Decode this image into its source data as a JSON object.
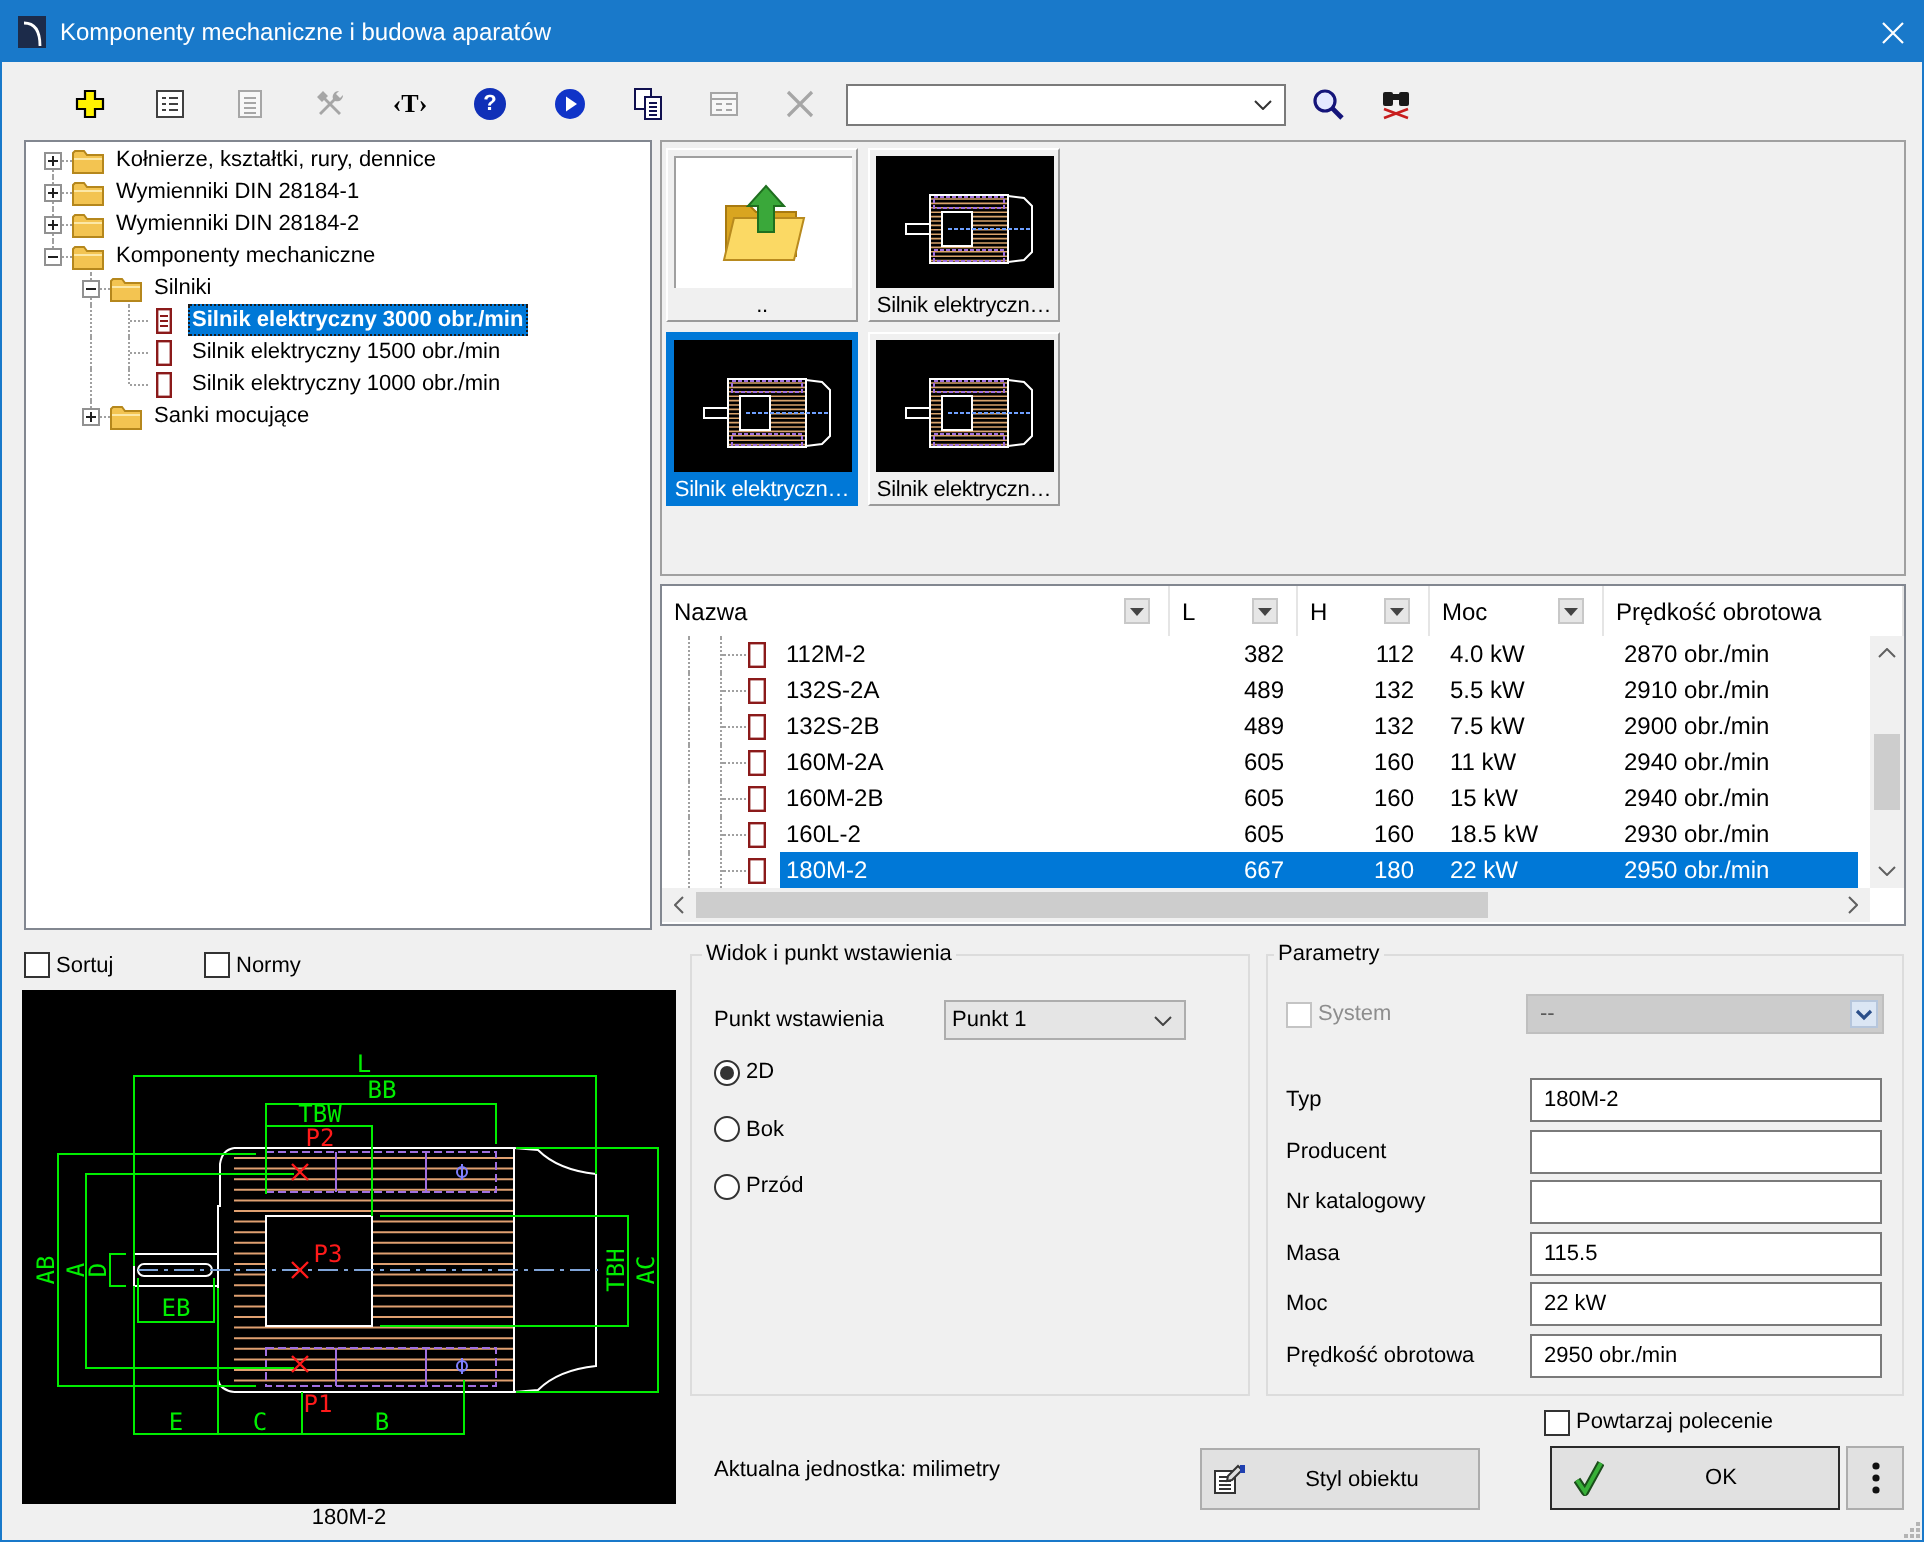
{
  "window": {
    "title": "Komponenty mechaniczne i budowa aparatów"
  },
  "toolbar": [
    {
      "kind": "add",
      "disabled": false
    },
    {
      "kind": "properties",
      "disabled": false
    },
    {
      "kind": "list",
      "disabled": true
    },
    {
      "kind": "tools",
      "disabled": true
    },
    {
      "kind": "text",
      "label": "‹T›",
      "disabled": false
    },
    {
      "kind": "help",
      "label": "?",
      "disabled": false
    },
    {
      "kind": "play",
      "disabled": false
    },
    {
      "kind": "copy",
      "disabled": false
    },
    {
      "kind": "table",
      "disabled": true
    },
    {
      "kind": "delete",
      "disabled": true
    },
    {
      "kind": "combo",
      "disabled": false
    },
    {
      "kind": "search",
      "disabled": false
    },
    {
      "kind": "find",
      "disabled": false
    }
  ],
  "tree": [
    {
      "kind": "folder",
      "label": "Kołnierze, kształtki, rury, dennice",
      "expanded": false,
      "selected": false
    },
    {
      "kind": "folder",
      "label": "Wymienniki DIN 28184-1",
      "expanded": false,
      "selected": false
    },
    {
      "kind": "folder",
      "label": "Wymienniki DIN 28184-2",
      "expanded": false,
      "selected": false
    },
    {
      "kind": "folder",
      "label": "Komponenty mechaniczne",
      "expanded": true,
      "selected": false,
      "children": [
        {
          "kind": "folder",
          "label": "Silniki",
          "expanded": true,
          "selected": false,
          "children": [
            {
              "kind": "item",
              "label": "Silnik elektryczny 3000 obr./min",
              "selected": true
            },
            {
              "kind": "item",
              "label": "Silnik elektryczny 1500 obr./min",
              "selected": false
            },
            {
              "kind": "item",
              "label": "Silnik elektryczny 1000 obr./min",
              "selected": false
            }
          ]
        },
        {
          "kind": "folder",
          "label": "Sanki mocujące",
          "expanded": false,
          "selected": false
        }
      ]
    }
  ],
  "thumbnails": [
    {
      "kind": "up",
      "label": "..",
      "selected": false
    },
    {
      "kind": "motor",
      "label": "Silnik elektryczn…",
      "selected": false
    },
    {
      "kind": "motor",
      "label": "Silnik elektryczn…",
      "selected": true
    },
    {
      "kind": "motor",
      "label": "Silnik elektryczn…",
      "selected": false
    }
  ],
  "table": {
    "columns": [
      {
        "label": "Nazwa",
        "filter": true
      },
      {
        "label": "L",
        "filter": true
      },
      {
        "label": "H",
        "filter": true
      },
      {
        "label": "Moc",
        "filter": true
      },
      {
        "label": "Prędkość obrotowa",
        "filter": false
      }
    ],
    "rows": [
      {
        "cells": [
          "112M-2",
          "382",
          "112",
          "4.0 kW",
          "2870 obr./min"
        ],
        "selected": false
      },
      {
        "cells": [
          "132S-2A",
          "489",
          "132",
          "5.5 kW",
          "2910 obr./min"
        ],
        "selected": false
      },
      {
        "cells": [
          "132S-2B",
          "489",
          "132",
          "7.5 kW",
          "2900 obr./min"
        ],
        "selected": false
      },
      {
        "cells": [
          "160M-2A",
          "605",
          "160",
          "11 kW",
          "2940 obr./min"
        ],
        "selected": false
      },
      {
        "cells": [
          "160M-2B",
          "605",
          "160",
          "15 kW",
          "2940 obr./min"
        ],
        "selected": false
      },
      {
        "cells": [
          "160L-2",
          "605",
          "160",
          "18.5 kW",
          "2930 obr./min"
        ],
        "selected": false
      },
      {
        "cells": [
          "180M-2",
          "667",
          "180",
          "22 kW",
          "2950 obr./min"
        ],
        "selected": true
      }
    ]
  },
  "options": [
    {
      "label": "Sortuj",
      "checked": false
    },
    {
      "label": "Normy",
      "checked": false
    }
  ],
  "preview": {
    "labels": [
      {
        "text": "L",
        "kind": "dimension"
      },
      {
        "text": "BB",
        "kind": "dimension"
      },
      {
        "text": "TBW",
        "kind": "dimension"
      },
      {
        "text": "P2",
        "kind": "point"
      },
      {
        "text": "AB",
        "kind": "dimension"
      },
      {
        "text": "A",
        "kind": "dimension"
      },
      {
        "text": "D",
        "kind": "dimension"
      },
      {
        "text": "EB",
        "kind": "dimension"
      },
      {
        "text": "P3",
        "kind": "point"
      },
      {
        "text": "TBH",
        "kind": "dimension"
      },
      {
        "text": "AC",
        "kind": "dimension"
      },
      {
        "text": "P1",
        "kind": "point"
      },
      {
        "text": "E",
        "kind": "dimension"
      },
      {
        "text": "C",
        "kind": "dimension"
      },
      {
        "text": "B",
        "kind": "dimension"
      }
    ],
    "caption": "180M-2"
  },
  "view": {
    "title": "Widok i punkt wstawienia",
    "insertion": {
      "label": "Punkt wstawienia",
      "value": "Punkt 1"
    },
    "modes": [
      {
        "label": "2D",
        "selected": true
      },
      {
        "label": "Bok",
        "selected": false
      },
      {
        "label": "Przód",
        "selected": false
      }
    ]
  },
  "parameters": {
    "title": "Parametry",
    "system": {
      "label": "System",
      "checked": false,
      "disabled": true
    },
    "system_choice": {
      "value": "--",
      "disabled": true
    },
    "fields": [
      {
        "label": "Typ",
        "value": "180M-2"
      },
      {
        "label": "Producent"
      },
      {
        "label": "Nr katalogowy"
      },
      {
        "label": "Masa",
        "value": "115.5"
      },
      {
        "label": "Moc",
        "value": "22 kW"
      },
      {
        "label": "Prędkość obrotowa",
        "value": "2950 obr./min"
      }
    ]
  },
  "unit_note": "Aktualna jednostka: milimetry",
  "style_button": {
    "label": "Styl obiektu"
  },
  "repeat": {
    "label": "Powtarzaj polecenie",
    "checked": false
  },
  "ok_button": {
    "label": "OK"
  }
}
